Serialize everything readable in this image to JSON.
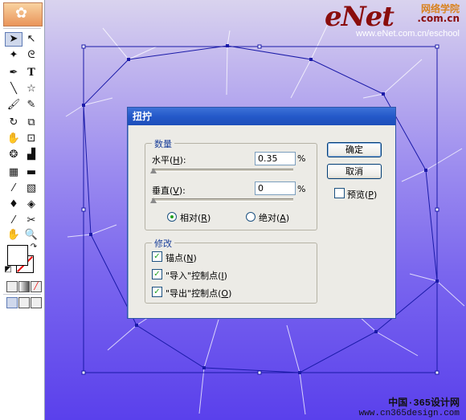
{
  "watermark": {
    "brand_e": "e",
    "brand_net": "Net",
    "brand_cn": "网络学院",
    "brand_domain": ".com.cn",
    "url": "www.eNet.com.cn/eschool",
    "bottom_line1": "中国·365设计网",
    "bottom_line2": "www.cn365design.com"
  },
  "dialog": {
    "title": "扭拧",
    "amount_group": "数量",
    "horizontal_label": "水平(",
    "horizontal_key": "H",
    "horizontal_value": "0.35",
    "vertical_label": "垂直(",
    "vertical_key": "V",
    "vertical_value": "0",
    "percent": "%",
    "relative_label": "相对(",
    "relative_key": "R",
    "absolute_label": "绝对(",
    "absolute_key": "A",
    "modify_group": "修改",
    "anchor_label": "锚点(",
    "anchor_key": "N",
    "import_label": "\"导入\"控制点(",
    "import_key": "I",
    "export_label": "\"导出\"控制点(",
    "export_key": "O",
    "close_paren": ")",
    "ok_button": "确定",
    "cancel_button": "取消",
    "preview_label": "预览(",
    "preview_key": "P",
    "selected_mode": "relative",
    "anchor_checked": true,
    "import_checked": true,
    "export_checked": true,
    "preview_checked": false
  },
  "tools": [
    "selection-tool",
    "direct-selection-tool",
    "magic-wand-tool",
    "lasso-tool",
    "pen-tool",
    "type-tool",
    "line-tool",
    "star-tool",
    "paintbrush-tool",
    "pencil-tool",
    "rotate-tool",
    "scale-tool",
    "warp-tool",
    "free-transform-tool",
    "symbol-sprayer-tool",
    "column-graph-tool",
    "mesh-tool",
    "gradient-tool",
    "eyedropper-tool",
    "blend-tool",
    "live-paint-tool",
    "live-paint-selection-tool",
    "slice-tool",
    "scissors-tool",
    "hand-tool",
    "zoom-tool"
  ],
  "colors": {
    "canvas_top": "#d9d3ee",
    "canvas_bottom": "#5a40ec",
    "path_stroke": "#1a1aa8",
    "dialog_title": "#2459c9"
  }
}
